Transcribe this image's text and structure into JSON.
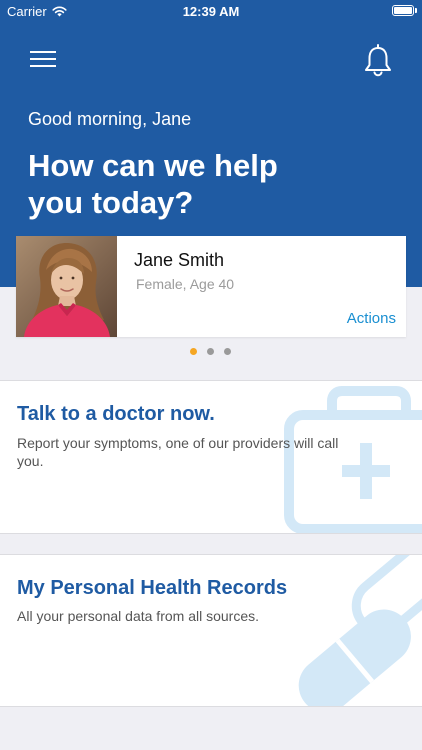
{
  "status_bar": {
    "carrier": "Carrier",
    "time": "12:39 AM"
  },
  "header": {
    "greeting": "Good morning, Jane",
    "headline": "How can we help you today?"
  },
  "profile": {
    "name": "Jane Smith",
    "meta": "Female, Age 40",
    "actions_label": "Actions"
  },
  "pager": {
    "pages": 3,
    "active": 0
  },
  "cards": {
    "doctor": {
      "title": "Talk to a doctor now.",
      "description": "Report your symptoms, one of our providers will call you."
    },
    "records": {
      "title": "My Personal Health Records",
      "description": "All your personal data from all sources."
    }
  },
  "colors": {
    "primary": "#1f5ba3",
    "accent": "#f5a623",
    "link": "#1a8fd1",
    "icon_watermark": "#d3e8f7"
  },
  "icons": [
    "hamburger-menu-icon",
    "bell-icon",
    "wifi-icon",
    "battery-icon",
    "medical-kit-icon",
    "pills-icon"
  ]
}
